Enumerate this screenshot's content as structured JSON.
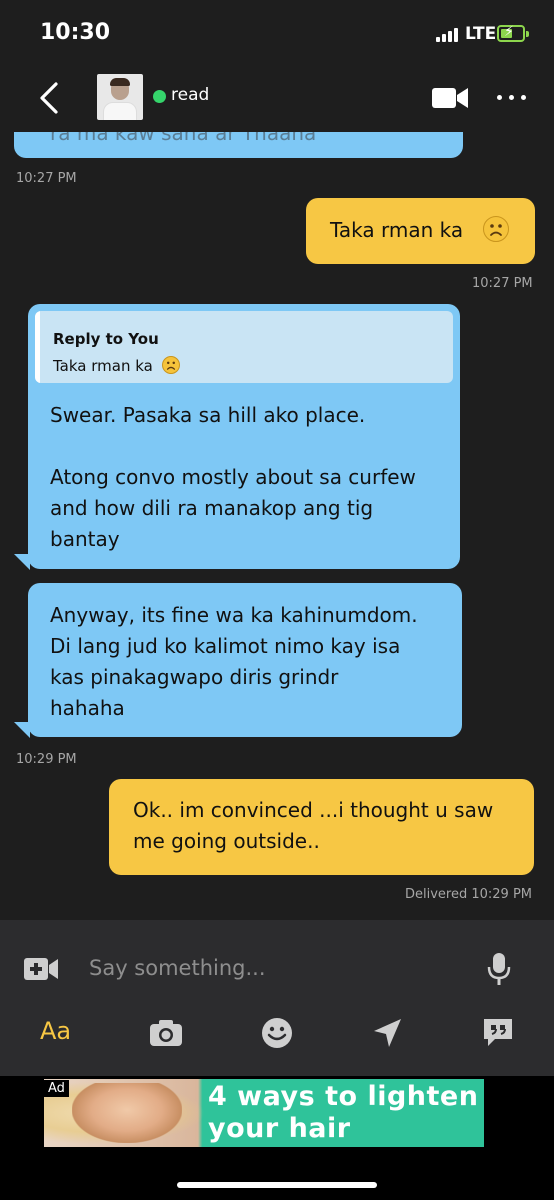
{
  "status_bar": {
    "time": "10:30",
    "network": "LTE",
    "battery_level": 0.55,
    "accent_color": "#8dd64d"
  },
  "header": {
    "status": "read",
    "status_color": "#35d46b",
    "icons": [
      "back-arrow",
      "video-camera",
      "more-dots"
    ]
  },
  "messages": [
    {
      "type": "incoming-partial",
      "text": "ra ma kaw sana ar Thaana"
    },
    {
      "type": "timestamp",
      "text": "10:27 PM"
    },
    {
      "type": "outgoing",
      "text": "Taka rman ka",
      "emoji": "sad-face"
    },
    {
      "type": "timestamp",
      "text": "10:27 PM"
    },
    {
      "type": "incoming",
      "reply_title": "Reply to You",
      "reply_text": "Taka rman ka",
      "text": "Swear. Pasaka sa hill ako place.\n\nAtong convo mostly about sa curfew\nand how dili ra manakop ang tig\nbantay"
    },
    {
      "type": "incoming",
      "text": "Anyway, its fine wa ka kahinumdom.\nDi lang jud ko kalimot nimo kay isa\nkas pinakagwapo diris grindr\nhahaha"
    },
    {
      "type": "timestamp",
      "text": "10:29 PM"
    },
    {
      "type": "outgoing",
      "text": "Ok.. im convinced ...i thought u saw\nme going outside.."
    },
    {
      "type": "timestamp",
      "text": "Delivered 10:29 PM"
    }
  ],
  "colors": {
    "incoming_bubble": "#7ec8f5",
    "outgoing_bubble": "#f7c744",
    "background": "#1e1e1e"
  },
  "input": {
    "placeholder": "Say something..."
  },
  "toolbar": {
    "text_label": "Aa",
    "icons": [
      "camera-icon",
      "smiley-icon",
      "location-arrow-icon",
      "quote-bubble-icon"
    ]
  },
  "ad": {
    "badge": "Ad",
    "line1": "4 ways to lighten",
    "line2": "your hair naturall"
  }
}
